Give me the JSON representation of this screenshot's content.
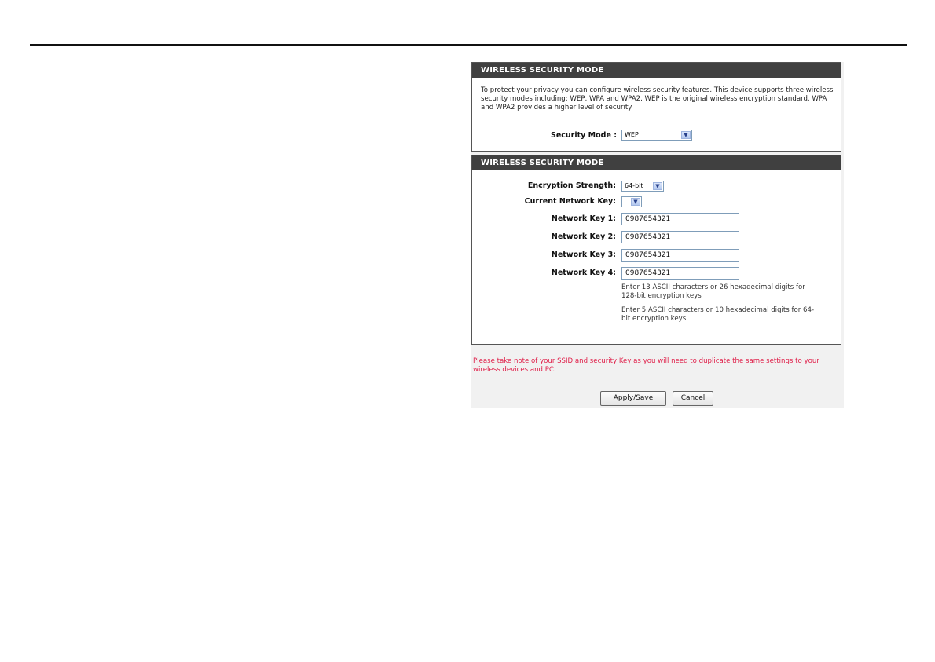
{
  "section1": {
    "title": "WIRELESS SECURITY MODE",
    "intro": "To protect your privacy you can configure wireless security features. This device supports three wireless security modes including: WEP, WPA and WPA2. WEP is the original wireless encryption standard. WPA and WPA2 provides a higher level of security.",
    "security_mode_label": "Security Mode :",
    "security_mode_value": "WEP"
  },
  "section2": {
    "title": "WIRELESS SECURITY MODE",
    "encryption_strength_label": "Encryption Strength:",
    "encryption_strength_value": "64-bit",
    "current_key_label": "Current Network Key:",
    "current_key_value": "",
    "keys": [
      {
        "label": "Network Key 1:",
        "value": "0987654321"
      },
      {
        "label": "Network Key 2:",
        "value": "0987654321"
      },
      {
        "label": "Network Key 3:",
        "value": "0987654321"
      },
      {
        "label": "Network Key 4:",
        "value": "0987654321"
      }
    ],
    "hint_128": "Enter 13 ASCII characters or 26 hexadecimal digits for 128-bit encryption keys",
    "hint_64": "Enter 5 ASCII characters or 10 hexadecimal digits for 64-bit encryption keys"
  },
  "note": "Please take note of your SSID and security Key as you will need to duplicate the same settings to your wireless devices and PC.",
  "buttons": {
    "apply": "Apply/Save",
    "cancel": "Cancel"
  },
  "icons": {
    "dropdown_arrow": "chevron-down-icon"
  },
  "colors": {
    "header_bg": "#404040",
    "note_text": "#e0204a"
  }
}
